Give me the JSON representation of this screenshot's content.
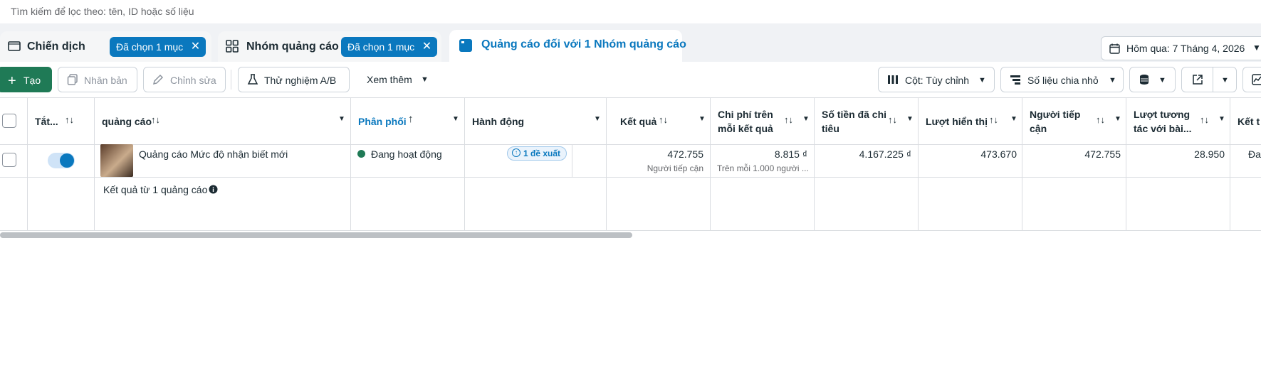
{
  "search": {
    "placeholder": "Tìm kiếm để lọc theo: tên, ID hoặc số liệu"
  },
  "tabs": [
    {
      "label": "Chiến dịch",
      "chip": "Đã chọn 1 mục",
      "icon": "folder-icon"
    },
    {
      "label": "Nhóm quảng cáo",
      "chip": "Đã chọn 1 mục",
      "icon": "grid-icon"
    },
    {
      "label": "Quảng cáo đối với 1 Nhóm quảng cáo",
      "icon": "ad-icon"
    }
  ],
  "date_range": {
    "label": "Hôm qua: 7 Tháng 4, 2026"
  },
  "toolbar": {
    "create": "Tạo",
    "duplicate": "Nhân bản",
    "edit": "Chỉnh sửa",
    "ab_test": "Thử nghiệm A/B",
    "more": "Xem thêm",
    "columns": "Cột: Tùy chỉnh",
    "breakdown": "Số liệu chia nhỏ"
  },
  "table": {
    "headers": {
      "toggle": "Tắt...",
      "ad": "quảng cáo",
      "delivery": "Phân phối",
      "actions": "Hành động",
      "results": "Kết quả",
      "cost_per_result": [
        "Chi phí trên",
        "mỗi kết quả"
      ],
      "amount_spent": [
        "Số tiền đã chi",
        "tiêu"
      ],
      "impressions": "Lượt hiển thị",
      "reach": [
        "Người tiếp",
        "cận"
      ],
      "engagement": [
        "Lượt tương",
        "tác với bài..."
      ],
      "last": "Kết t"
    },
    "row": {
      "ad_name": "Quảng cáo Mức độ nhận biết mới",
      "delivery": "Đang hoạt động",
      "recommendation": "1 đề xuất",
      "results": "472.755",
      "results_sub": "Người tiếp cận",
      "cost_per_result": "8.815 ₫",
      "cost_sub": "Trên mỗi 1.000 người ...",
      "amount_spent": "4.167.225 ₫",
      "impressions": "473.670",
      "reach": "472.755",
      "engagement": "28.950",
      "last": "Đa"
    },
    "summary": "Kết quả từ 1 quảng cáo"
  },
  "colors": {
    "accent": "#0a78be",
    "create": "#1f7a56",
    "active": "#1f7a56"
  }
}
